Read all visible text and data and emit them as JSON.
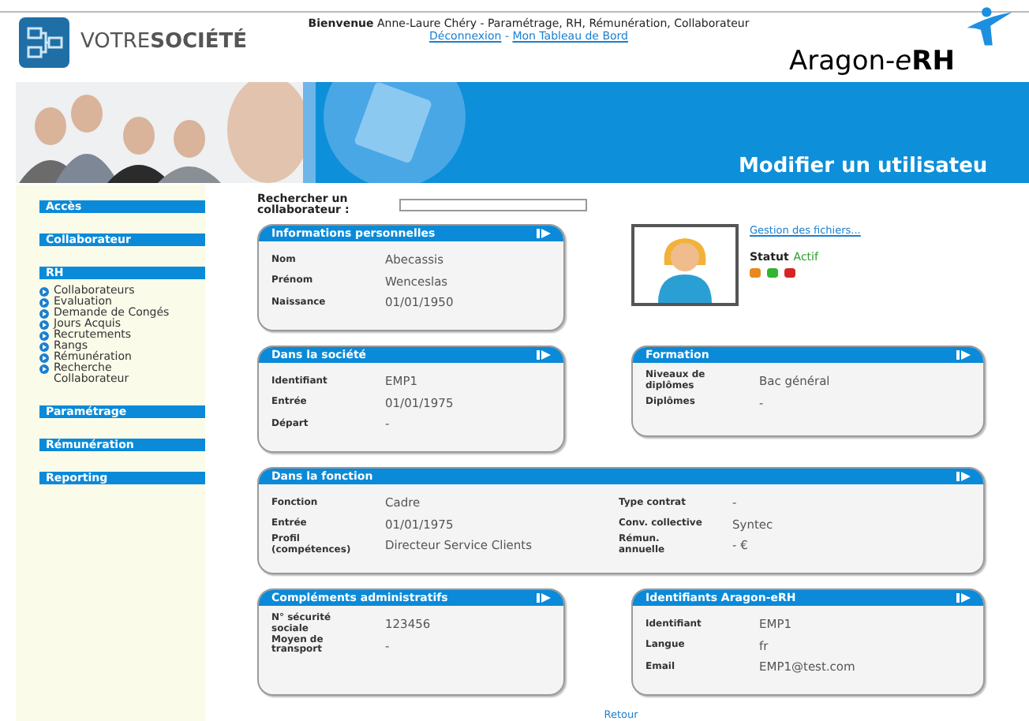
{
  "header": {
    "company": "VOTRE**SOCIÉTÉ**",
    "welcome": "**Bienvenue** Anne-Laure Chéry - Paramétrage, RH, Rémunération, Collaborateur",
    "links": [
      "Déconnexion",
      "Mon Tableau de Bord"
    ],
    "separator": "-",
    "brand": [
      "Aragon-",
      "e",
      "RH"
    ]
  },
  "banner": {
    "title": "Modifier un utilisateu"
  },
  "sidebar": {
    "sections": [
      {
        "title": "Accès"
      },
      {
        "title": "Collaborateur"
      },
      {
        "title": "RH",
        "items": [
          "Collaborateurs",
          "Evaluation",
          "Demande de Congés",
          "Jours Acquis",
          "Recrutements",
          "Rangs",
          "Rémunération",
          "Recherche Collaborateur"
        ]
      },
      {
        "title": "Paramétrage"
      },
      {
        "title": "Rémunération"
      },
      {
        "title": "Reporting"
      }
    ]
  },
  "search": {
    "label": "Rechercher un collaborateur :"
  },
  "profile": {
    "files_link": "Gestion des fichiers...",
    "status_label": "Statut",
    "status_value": "Actif",
    "status_buttons": [
      {
        "color": "#e8891c"
      },
      {
        "color": "#2fb52f"
      },
      {
        "color": "#d42424"
      }
    ]
  },
  "panels": [
    {
      "title": "Informations personnelles",
      "kind": "half",
      "columns": [
        [
          {
            "label": "Nom",
            "value": "Abecassis"
          },
          {
            "label": "Prénom",
            "value": "Wenceslas"
          },
          {
            "label": "Naissance",
            "value": "01/01/1950"
          }
        ]
      ]
    },
    {
      "title": "Dans la société",
      "kind": "half",
      "columns": [
        [
          {
            "label": "Identifiant",
            "value": "EMP1"
          },
          {
            "label": "Entrée",
            "value": "01/01/1975"
          },
          {
            "label": "Départ",
            "value": "-"
          }
        ]
      ]
    },
    {
      "title": "Formation",
      "kind": "half",
      "columns": [
        [
          {
            "label": "Niveaux de diplômes",
            "value": "Bac général"
          },
          {
            "label": "Diplômes",
            "value": "-"
          }
        ]
      ]
    },
    {
      "title": "Dans la fonction",
      "kind": "full",
      "columns": [
        [
          {
            "label": "Fonction",
            "value": "Cadre"
          },
          {
            "label": "Entrée",
            "value": "01/01/1975"
          },
          {
            "label": "Profil (compétences)",
            "value": "Directeur Service Clients"
          }
        ],
        [
          {
            "label": "Type contrat",
            "value": "-"
          },
          {
            "label": "Conv. collective",
            "value": "Syntec"
          },
          {
            "label": "Rémun. annuelle",
            "value": "- €"
          }
        ]
      ]
    },
    {
      "title": "Compléments administratifs",
      "kind": "half",
      "columns": [
        [
          {
            "label": "N° sécurité sociale",
            "value": "123456"
          },
          {
            "label": "Moyen de transport",
            "value": "-"
          }
        ]
      ]
    },
    {
      "title": "Identifiants Aragon-eRH",
      "kind": "half",
      "columns": [
        [
          {
            "label": "Identifiant",
            "value": "EMP1"
          },
          {
            "label": "Langue",
            "value": "fr"
          },
          {
            "label": "Email",
            "value": "EMP1@test.com"
          }
        ]
      ]
    }
  ],
  "back_link": "Retour"
}
